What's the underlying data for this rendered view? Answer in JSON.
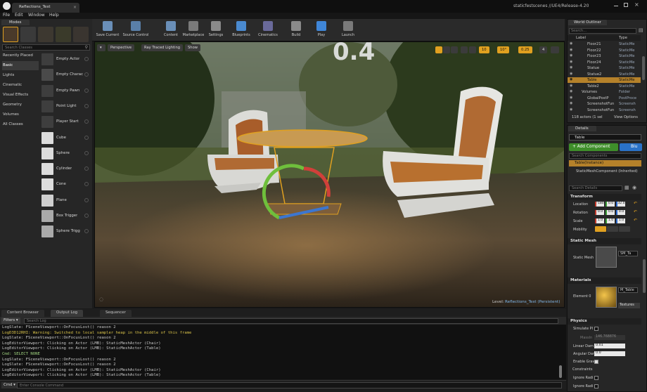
{
  "titlebar": {
    "tab_title": "Reflections_Test",
    "project_path": "staticfestscenes //UE4/Release-4.20"
  },
  "menu": [
    "File",
    "Edit",
    "Window",
    "Help"
  ],
  "modes": {
    "tab_label": "Modes",
    "search_placeholder": "Search Classes",
    "categories": [
      "Recently Placed",
      "Basic",
      "Lights",
      "Cinematic",
      "Visual Effects",
      "Geometry",
      "Volumes",
      "All Classes"
    ],
    "selected_category": "Basic",
    "items": [
      "Empty Actor",
      "Empty Charac",
      "Empty Pawn",
      "Point Light",
      "Player Start",
      "Cube",
      "Sphere",
      "Cylinder",
      "Cone",
      "Plane",
      "Box Trigger",
      "Sphere Trigg"
    ]
  },
  "toolbar": {
    "buttons": [
      "Save Current",
      "Source Control",
      "Content",
      "Marketplace",
      "Settings",
      "Blueprints",
      "Cinematics",
      "Build",
      "Play",
      "Launch"
    ]
  },
  "viewport": {
    "view_mode": "Perspective",
    "lighting_mode": "Ray Traced Lighting",
    "show_label": "Show",
    "overlay_text": "0.4",
    "snap_values": [
      "10",
      "10°",
      "0.25"
    ],
    "camera_speed": "4",
    "level_label": "Level:",
    "level_name": "Reflections_Test (Persistent)"
  },
  "outliner": {
    "tab_label": "World Outliner",
    "search_placeholder": "Search...",
    "col_label": "Label",
    "col_type": "Type",
    "rows": [
      {
        "label": "Floor21",
        "type": "StaticMe"
      },
      {
        "label": "Floor22",
        "type": "StaticMe"
      },
      {
        "label": "Floor23",
        "type": "StaticMe"
      },
      {
        "label": "Floor24",
        "type": "StaticMe"
      },
      {
        "label": "Statue",
        "type": "StaticMe"
      },
      {
        "label": "Statue2",
        "type": "StaticMe"
      },
      {
        "label": "Table",
        "type": "StaticMe"
      },
      {
        "label": "Table2",
        "type": "StaticMe"
      },
      {
        "label": "Volumes",
        "type": "Folder"
      },
      {
        "label": "GlobalPostP",
        "type": "PostProce"
      },
      {
        "label": "ScreenshotFun",
        "type": "Screensh"
      },
      {
        "label": "ScreenshotFun",
        "type": "Screensh"
      }
    ],
    "footer_count": "118 actors (1 sel",
    "view_options": "View Options"
  },
  "details": {
    "tab_label": "Details",
    "actor_name": "Table",
    "add_component": "+ Add Component",
    "blueprint_btn": "Blu",
    "search_placeholder": "Search Components",
    "instance_label": "Table(Instance)",
    "component_label": "StaticMeshComponent (Inherited)",
    "search2_placeholder": "Search Details",
    "transform": {
      "header": "Transform",
      "location_label": "Location",
      "location": [
        "-180",
        "0.0",
        "32.0"
      ],
      "rotation_label": "Rotation",
      "rotation": [
        "0.0",
        "0.0",
        "0.0"
      ],
      "scale_label": "Scale",
      "scale": [
        "1.0",
        "1.0",
        "1.0"
      ],
      "mobility_label": "Mobility"
    },
    "static_mesh": {
      "header": "Static Mesh",
      "label": "Static Mesh",
      "value": "SM_Ta"
    },
    "materials": {
      "header": "Materials",
      "label": "Element 0",
      "value": "M_Table",
      "dropdown": "Textures"
    },
    "physics": {
      "header": "Physics",
      "simulate": "Simulate Pl",
      "mass_label": "MassIn",
      "mass_value": "146.768876",
      "linear_label": "Linear Dam",
      "linear_value": "0.01",
      "angular_label": "Angular Dar",
      "angular_value": "0.0",
      "gravity_label": "Enable Grav",
      "constraints": "Constraints",
      "ignore1": "Ignore Radi",
      "ignore2": "Ignore Radi"
    }
  },
  "bottom": {
    "tabs": [
      "Content Browser",
      "Output Log",
      "Sequencer"
    ],
    "filters": "Filters",
    "search_placeholder": "Search Log",
    "log_lines": [
      "LogSlate: FSceneViewport::OnFocusLost() reason 2",
      "LogD3D12RHI: Warning: Switched to local sampler heap in the middle of this frame",
      "LogSlate: FSceneViewport::OnFocusLost() reason 2",
      "LogEditorViewport: Clicking on Actor (LMB): StaticMeshActor (Chair)",
      "LogEditorViewport: Clicking on Actor (LMB): StaticMeshActor (Table)",
      "Cmd: SELECT NONE",
      "LogSlate: FSceneViewport::OnFocusLost() reason 2",
      "LogSlate: FSceneViewport::OnFocusLost() reason 2",
      "LogEditorViewport: Clicking on Actor (LMB): StaticMeshActor (Chair)",
      "LogEditorViewport: Clicking on Actor (LMB): StaticMeshActor (Table)"
    ],
    "cmd_label": "Cmd",
    "cmd_placeholder": "Enter Console Command"
  },
  "colors": {
    "accent_orange": "#e0a020",
    "selection_orange": "#b5812a",
    "add_component_green": "#3e8e2a",
    "blueprint_blue": "#2a72c8",
    "warning_yellow": "#d8c24a",
    "cmd_green": "#9fd27f"
  }
}
